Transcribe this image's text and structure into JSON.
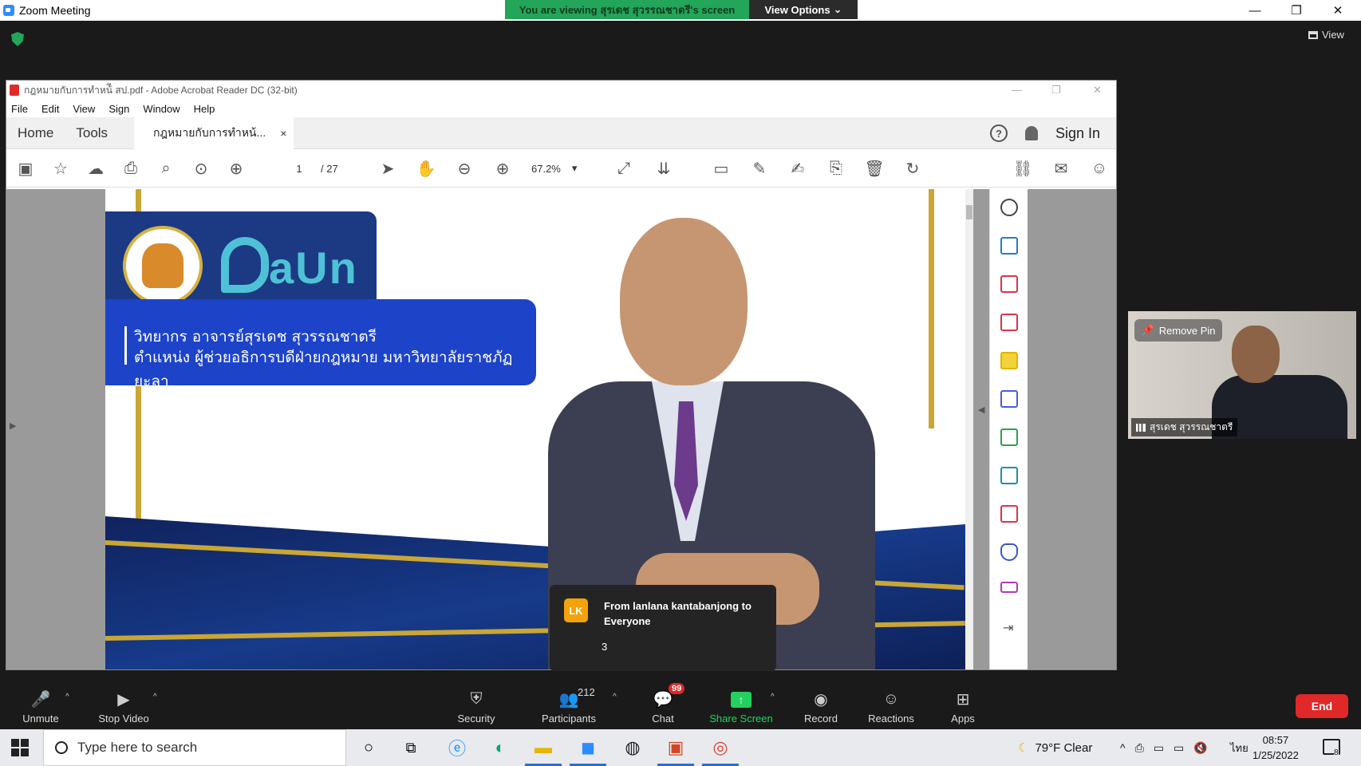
{
  "zoom": {
    "window_title": "Zoom Meeting",
    "viewing_banner": "You are viewing สุรเดช สุวรรณชาตรี's screen",
    "view_options": "View Options",
    "view_label": "View",
    "colors": {
      "banner_green": "#23a55a",
      "end_red": "#e02828",
      "share_green": "#23d160"
    }
  },
  "acrobat": {
    "window_title": "กฎหมายกับการทำหน้ี สป.pdf - Adobe Acrobat Reader DC (32-bit)",
    "menu": [
      "File",
      "Edit",
      "View",
      "Sign",
      "Window",
      "Help"
    ],
    "tabs": {
      "home": "Home",
      "tools": "Tools",
      "document": "กฎหมายกับการทำหน้...",
      "close": "×"
    },
    "sign_in": "Sign In",
    "help": "?",
    "page_current": "1",
    "page_total": "/ 27",
    "zoom": "67.2%",
    "toolbar_icons": [
      "save-icon",
      "star-icon",
      "upload-icon",
      "print-icon",
      "zoom-out-search-icon",
      "prev-page-icon",
      "next-page-icon",
      "select-icon",
      "hand-icon",
      "minus-icon",
      "plus-icon",
      "fit-icon",
      "scroll-icon",
      "comment-icon",
      "highlight-icon",
      "sign-icon",
      "stamp-icon",
      "delete-icon",
      "rotate-icon",
      "link-icon",
      "mail-icon",
      "account-icon"
    ]
  },
  "slide": {
    "logo_text": "aUn",
    "speaker_line1": "วิทยากร อาจารย์สุรเดช สุวรรณชาตรี",
    "speaker_line2": "ตำแหน่ง ผู้ช่วยอธิการบดีฝ่ายกฎหมาย มหาวิทยาลัยราชภัฏยะลา"
  },
  "chat_toast": {
    "avatar": "LK",
    "from": "From lanlana kantabanjong to Everyone",
    "message": "3"
  },
  "video_tile": {
    "remove_pin": "Remove Pin",
    "participant_name": "สุรเดช สุวรรณชาตรี"
  },
  "controls": {
    "unmute": "Unmute",
    "stop_video": "Stop Video",
    "security": "Security",
    "participants": "Participants",
    "participants_count": "212",
    "chat": "Chat",
    "chat_badge": "99",
    "share_screen": "Share Screen",
    "record": "Record",
    "reactions": "Reactions",
    "apps": "Apps",
    "end": "End"
  },
  "taskbar": {
    "search_placeholder": "Type here to search",
    "weather": "79°F  Clear",
    "language": "ไทย",
    "time": "08:57",
    "date": "1/25/2022",
    "notifications": "8"
  }
}
